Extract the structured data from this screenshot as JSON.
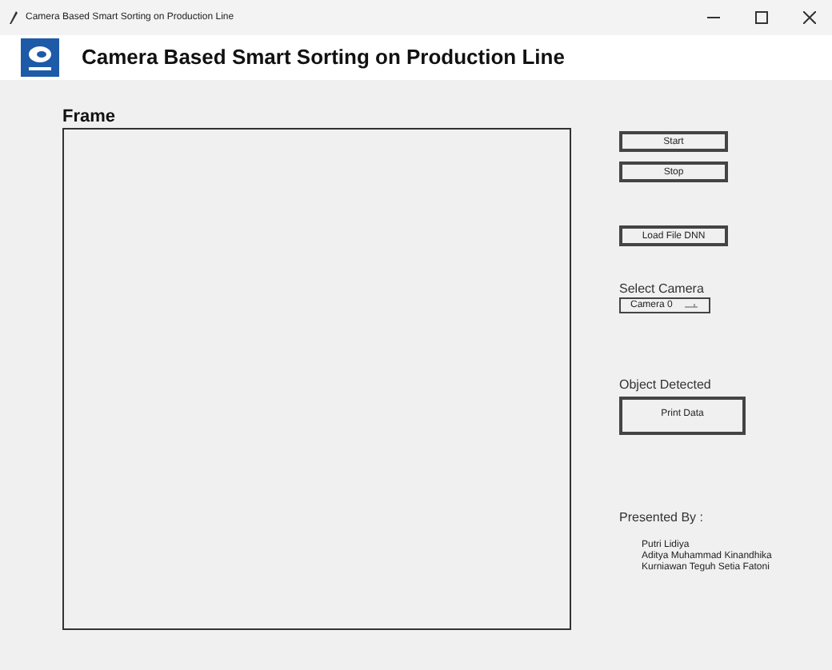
{
  "window": {
    "title": "Camera Based Smart Sorting on Production Line"
  },
  "header": {
    "title": "Camera Based Smart Sorting on Production Line"
  },
  "frame": {
    "label": "Frame"
  },
  "buttons": {
    "start": "Start",
    "stop": "Stop",
    "load": "Load File DNN"
  },
  "camera": {
    "label": "Select Camera",
    "value": "Camera 0"
  },
  "detection": {
    "label": "Object Detected",
    "button": "Print Data"
  },
  "credits": {
    "label": "Presented By :",
    "names": [
      "Putri Lidiya",
      "Aditya Muhammad Kinandhika",
      "Kurniawan Teguh Setia Fatoni"
    ]
  }
}
